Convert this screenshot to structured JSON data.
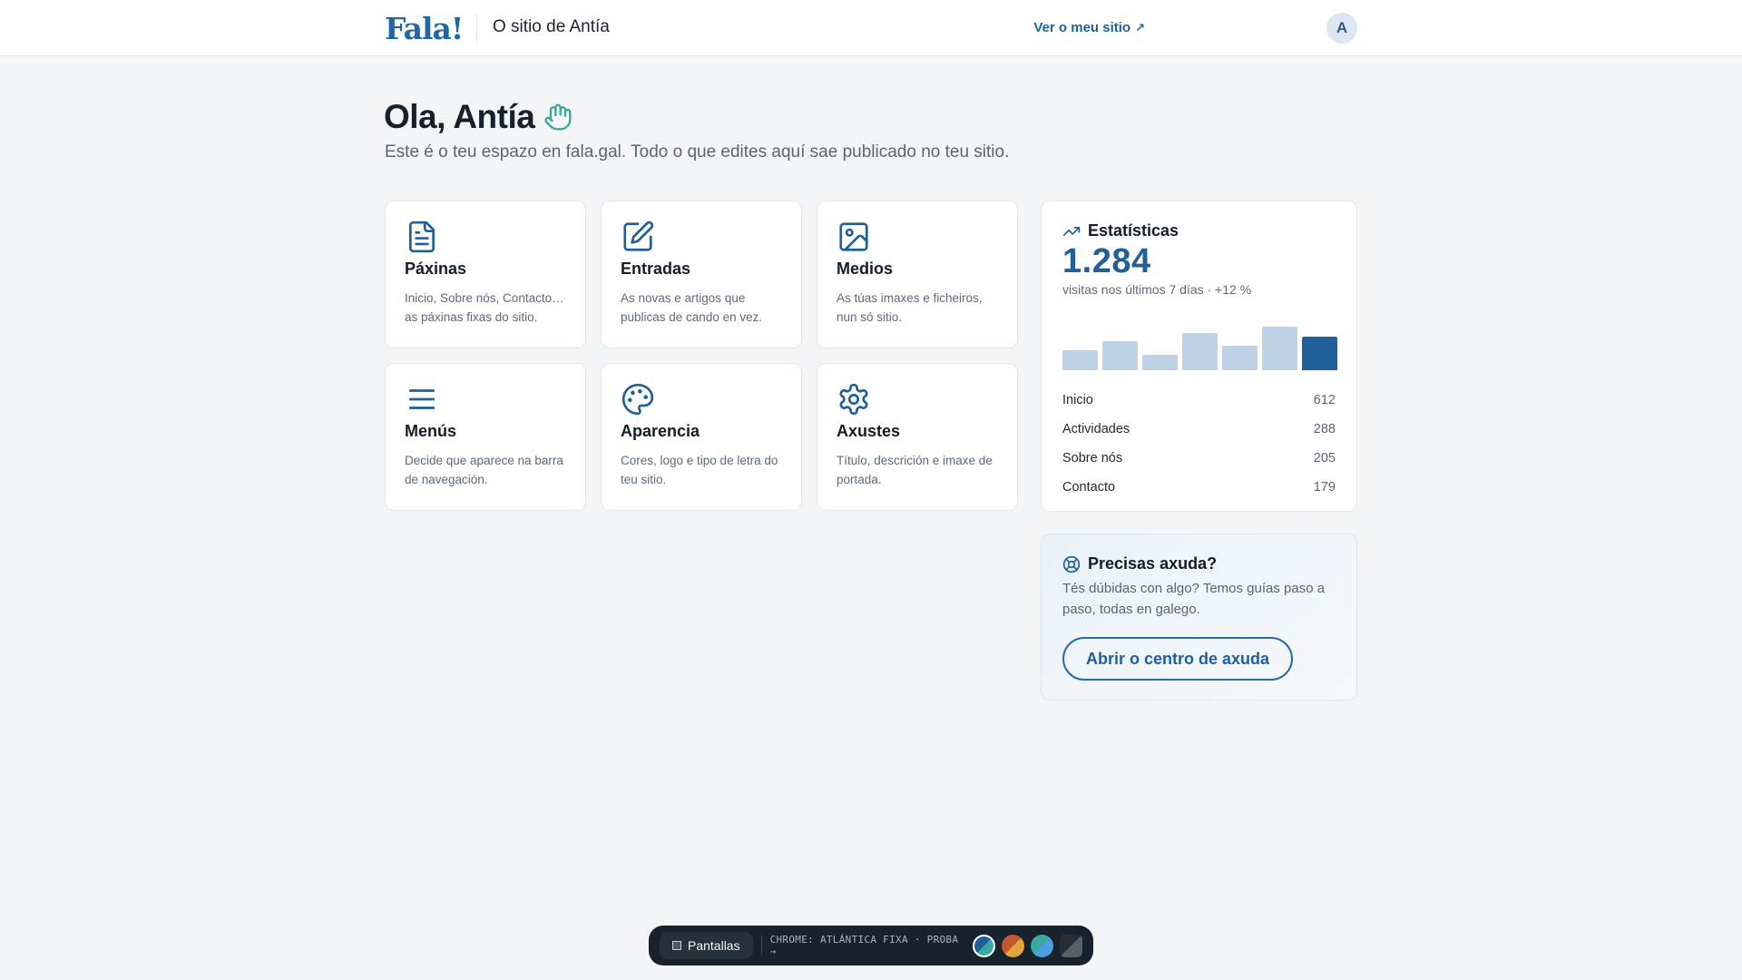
{
  "header": {
    "logo": "Fala!",
    "site_name": "O sitio de Antía",
    "view_site": "Ver o meu sitio",
    "view_site_arrow": "↗",
    "avatar_initial": "A"
  },
  "welcome": {
    "title": "Ola, Antía",
    "subtitle": "Este é o teu espazo en fala.gal. Todo o que edites aquí sae publicado no teu sitio."
  },
  "cards": [
    {
      "title": "Páxinas",
      "desc": "Inicio, Sobre nós, Contacto… as páxinas fixas do sitio.",
      "icon": "document-icon"
    },
    {
      "title": "Entradas",
      "desc": "As novas e artigos que publicas de cando en vez.",
      "icon": "edit-icon"
    },
    {
      "title": "Medios",
      "desc": "As túas imaxes e ficheiros, nun só sitio.",
      "icon": "image-icon"
    },
    {
      "title": "Menús",
      "desc": "Decide que aparece na barra de navegación.",
      "icon": "menu-icon"
    },
    {
      "title": "Aparencia",
      "desc": "Cores, logo e tipo de letra do teu sitio.",
      "icon": "palette-icon"
    },
    {
      "title": "Axustes",
      "desc": "Título, descrición e imaxe de portada.",
      "icon": "gear-icon"
    }
  ],
  "stats": {
    "title": "Estatísticas",
    "total": "1.284",
    "caption": "visitas nos últimos 7 días · +12 %",
    "daily_visits": [
      0.45,
      0.66,
      0.35,
      0.85,
      0.56,
      1.0,
      0.78
    ],
    "top_pages": [
      {
        "name": "Inicio",
        "value": "612"
      },
      {
        "name": "Actividades",
        "value": "288"
      },
      {
        "name": "Sobre nós",
        "value": "205"
      },
      {
        "name": "Contacto",
        "value": "179"
      }
    ]
  },
  "help": {
    "title": "Precisas axuda?",
    "text": "Tés dúbidas con algo? Temos guías paso a paso, todas en galego.",
    "button": "Abrir o centro de axuda"
  },
  "dock": {
    "button": "Pantallas",
    "meta": "CHROME: ATLÁNTICA FIXA · PROBA →"
  },
  "colors": {
    "accent": "#1f5f9a",
    "bar_light": "#bed3e5",
    "wave_icon": "#3aa99f"
  }
}
